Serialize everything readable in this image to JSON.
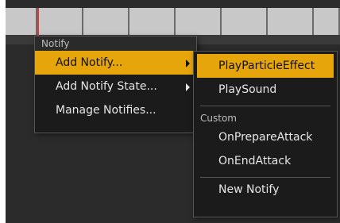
{
  "colors": {
    "background": "#2b2b2b",
    "menu_bg": "#1b1b1b",
    "highlight": "#e5a50b",
    "playhead": "#d33a3a"
  },
  "context_menu": {
    "section_title": "Notify",
    "items": [
      {
        "label": "Add Notify...",
        "has_submenu": true,
        "highlighted": true
      },
      {
        "label": "Add Notify State...",
        "has_submenu": true,
        "highlighted": false
      },
      {
        "label": "Manage Notifies...",
        "has_submenu": false,
        "highlighted": false
      }
    ]
  },
  "submenu": {
    "items_top": [
      {
        "label": "PlayParticleEffect",
        "highlighted": true
      },
      {
        "label": "PlaySound",
        "highlighted": false
      }
    ],
    "custom_section_title": "Custom",
    "custom_items": [
      {
        "label": "OnPrepareAttack"
      },
      {
        "label": "OnEndAttack"
      }
    ],
    "new_notify_label": "New Notify"
  }
}
